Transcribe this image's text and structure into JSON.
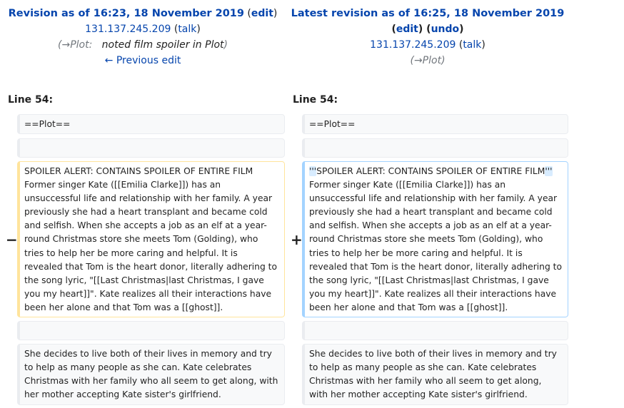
{
  "left_header": {
    "title": "Revision as of 16:23, 18 November 2019",
    "edit_label": "edit",
    "user_ip": "131.137.245.209",
    "talk_label": "talk",
    "comment_section": "→Plot:",
    "comment_text": "noted film spoiler in Plot",
    "previous_edit_label": "← Previous edit"
  },
  "right_header": {
    "title": "Latest revision as of 16:25, 18 November 2019",
    "edit_label": "edit",
    "undo_label": "undo",
    "user_ip": "131.137.245.209",
    "talk_label": "talk",
    "comment_section": "→Plot"
  },
  "line_numbers": {
    "left": "Line 54:",
    "right": "Line 54:"
  },
  "diff": {
    "context_plot": "==Plot==",
    "deleted_text": "SPOILER ALERT: CONTAINS SPOILER OF ENTIRE FILM Former singer Kate ([[Emilia Clarke]]) has an unsuccessful life and relationship with her family. A year previously she had a heart transplant and became cold and selfish. When she accepts a job as an elf at a year-round Christmas store she meets Tom (Golding), who tries to help her be more caring and helpful. It is revealed that Tom is the heart donor, literally adhering to the song lyric, \"[[Last Christmas|last Christmas, I gave you my heart]]\". Kate realizes all their interactions have been her alone and that Tom was a [[ghost]].",
    "added_mark_open": "'''",
    "added_spoiler": "SPOILER ALERT: CONTAINS SPOILER OF ENTIRE FILM",
    "added_mark_close": "'''",
    "added_rest": "Former singer Kate ([[Emilia Clarke]]) has an unsuccessful life and relationship with her family. A year previously she had a heart transplant and became cold and selfish. When she accepts a job as an elf at a year-round Christmas store she meets Tom (Golding), who tries to help her be more caring and helpful. It is revealed that Tom is the heart donor, literally adhering to the song lyric, \"[[Last Christmas|last Christmas, I gave you my heart]]\". Kate realizes all their interactions have been her alone and that Tom was a [[ghost]].",
    "deleted_marker": "−",
    "added_marker": "+",
    "context_last": "She decides to live both of their lives in memory and try to help as many people as she can. Kate celebrates Christmas with her family who all seem to get along, with her mother accepting Kate sister's girlfriend."
  }
}
